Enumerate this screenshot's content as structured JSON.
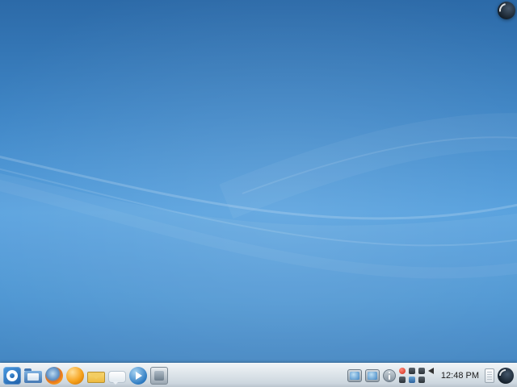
{
  "colors": {
    "wallpaper_top": "#2c6aa8",
    "wallpaper_mid": "#549fdd",
    "wallpaper_bottom": "#3579b8",
    "wave_highlight": "#ffffff",
    "panel_bg_top": "#f0f4f7",
    "panel_bg_bottom": "#b9c4cd",
    "clock_text": "#1c1c1c"
  },
  "desktop": {
    "toolbox_icon": "cashew-icon"
  },
  "panel": {
    "launcher_icons": [
      "kde-menu-icon",
      "folder-icon",
      "firefox-icon",
      "orange-app-icon",
      "mail-icon",
      "chat-icon",
      "media-player-icon",
      "system-app-icon"
    ],
    "tray_icons": [
      "device-notifier-icon",
      "camera-device-icon",
      "info-icon",
      "status-badge-icons",
      "volume-icon"
    ],
    "clock": {
      "time": "12:48 PM"
    },
    "toolbox_icon": "panel-cashew-icon"
  }
}
